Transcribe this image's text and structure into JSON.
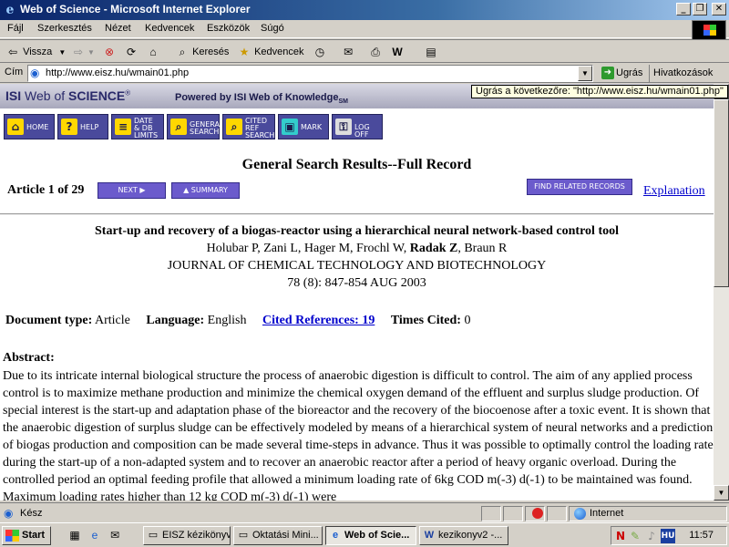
{
  "window": {
    "title": "Web of Science - Microsoft Internet Explorer",
    "minimize": "_",
    "maximize": "❐",
    "close": "✕"
  },
  "menu": [
    "Fájl",
    "Szerkesztés",
    "Nézet",
    "Kedvencek",
    "Eszközök",
    "Súgó"
  ],
  "toolbar": {
    "back": "Vissza",
    "search": "Keresés",
    "favorites": "Kedvencek"
  },
  "address": {
    "label": "Cím",
    "url": "http://www.eisz.hu/wmain01.php",
    "go": "Ugrás",
    "links": "Hivatkozások",
    "tooltip": "Ugrás a következőre: \"http://www.eisz.hu/wmain01.php\""
  },
  "isi": {
    "brand_prefix": "ISI",
    "brand_mid": " Web of ",
    "brand_strong": "SCIENCE",
    "brand_reg": "®",
    "powered": "Powered by ISI Web of Knowledge",
    "powered_sub": "SM",
    "nav": [
      {
        "lines": [
          "HOME"
        ],
        "icon": "⌂"
      },
      {
        "lines": [
          "HELP"
        ],
        "icon": "?"
      },
      {
        "lines": [
          "DATE",
          "& DB",
          "LIMITS"
        ],
        "icon": "≡"
      },
      {
        "lines": [
          "GENERAL",
          "SEARCH"
        ],
        "icon": "⌕"
      },
      {
        "lines": [
          "CITED",
          "REF",
          "SEARCH"
        ],
        "icon": "⌕"
      },
      {
        "lines": [
          "MARK"
        ],
        "icon": "▣"
      },
      {
        "lines": [
          "LOG OFF"
        ],
        "icon": "⚿"
      }
    ]
  },
  "page": {
    "heading": "General Search Results--Full Record",
    "article_label": "Article 1 of 29",
    "next": "NEXT",
    "summary": "SUMMARY",
    "find_related": "FIND RELATED RECORDS",
    "explanation": "Explanation"
  },
  "record": {
    "title": "Start-up and recovery of a biogas-reactor using a hierarchical neural network-based control tool",
    "authors_before": "Holubar P, Zani L, Hager M, Frochl W, ",
    "authors_bold": "Radak Z",
    "authors_after": ", Braun R",
    "journal": "JOURNAL OF CHEMICAL TECHNOLOGY AND BIOTECHNOLOGY",
    "volume": "78 (8): 847-854 AUG 2003",
    "doc_type_label": "Document type:",
    "doc_type": "Article",
    "language_label": "Language:",
    "language": "English",
    "cited_refs": "Cited References: 19",
    "times_cited_label": "Times Cited:",
    "times_cited": "0",
    "abstract_label": "Abstract:",
    "abstract": "Due to its intricate internal biological structure the process of anaerobic digestion is difficult to control. The aim of any applied process control is to maximize methane production and minimize the chemical oxygen demand of the effluent and surplus sludge production. Of special interest is the start-up and adaptation phase of the bioreactor and the recovery of the biocoenose after a toxic event. It is shown that the anaerobic digestion of surplus sludge can be effectively modeled by means of a hierarchical system of neural networks and a prediction of biogas production and composition can be made several time-steps in advance. Thus it was possible to optimally control the loading rate during the start-up of a non-adapted system and to recover an anaerobic reactor after a period of heavy organic overload. During the controlled period an optimal feeding profile that allowed a minimum loading rate of 6kg COD m(-3) d(-1) to be maintained was found. Maximum loading rates higher than 12 kg COD m(-3) d(-1) were"
  },
  "status": {
    "text": "Kész",
    "zone": "Internet"
  },
  "taskbar": {
    "start": "Start",
    "tasks": [
      "EISZ kézikönyv",
      "Oktatási Mini...",
      "Web of Scie...",
      "kezikonyv2 -..."
    ],
    "lang": "HU",
    "clock": "11:57"
  },
  "colors": {
    "title_bar": "#0a246a",
    "isi_purple": "#4a4a9c",
    "link": "#0000cc"
  }
}
